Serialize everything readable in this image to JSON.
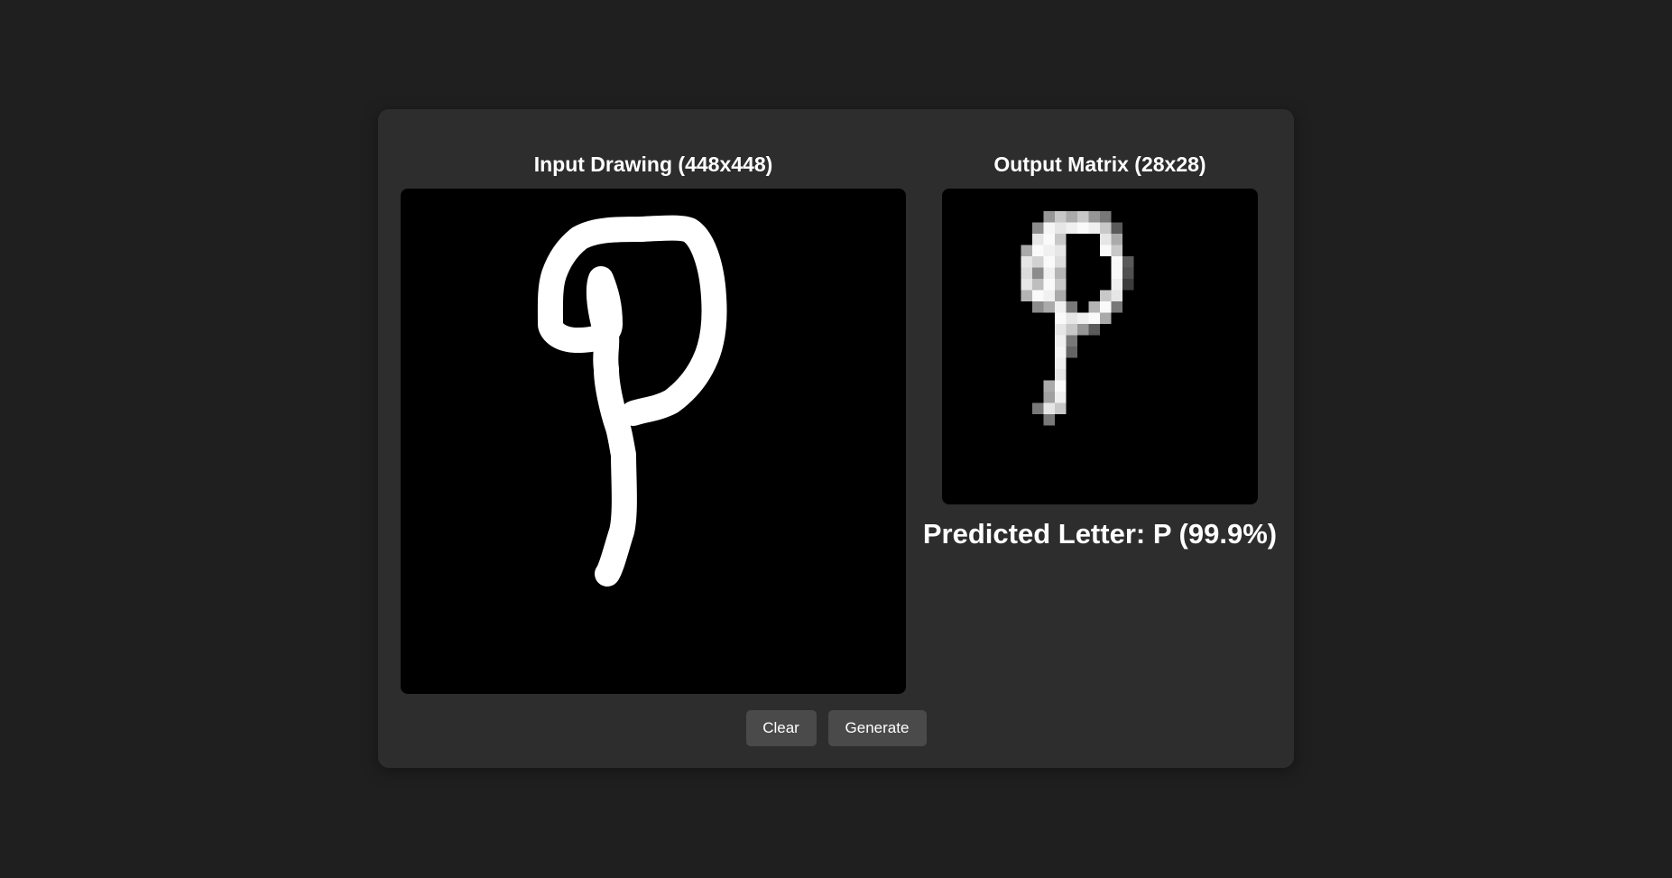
{
  "input_panel": {
    "title": "Input Drawing (448x448)"
  },
  "output_panel": {
    "title": "Output Matrix (28x28)",
    "prediction": "Predicted Letter: P (99.9%)"
  },
  "buttons": {
    "clear_label": "Clear",
    "generate_label": "Generate"
  },
  "colors": {
    "page_background": "#1f1f1f",
    "panel_background": "#2d2d2d",
    "canvas_background": "#000000",
    "button_background": "#4a4a4a",
    "text": "#ffffff"
  }
}
